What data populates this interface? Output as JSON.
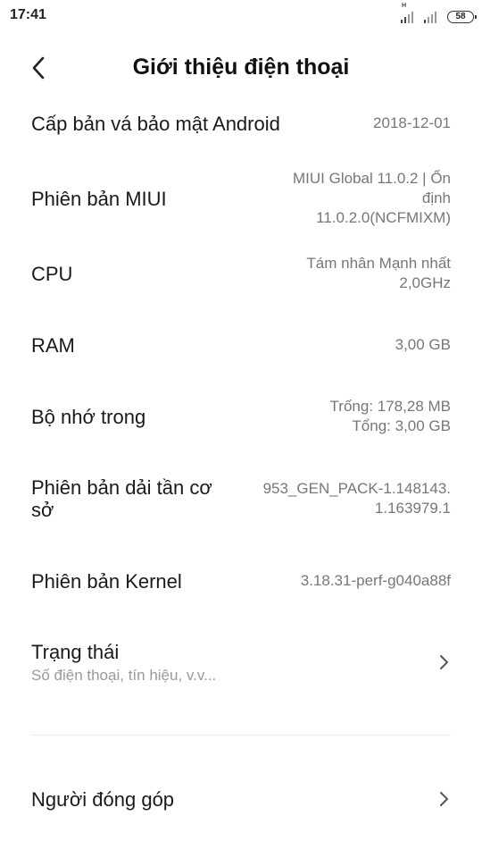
{
  "status_bar": {
    "time": "17:41",
    "signal1_tag": "H",
    "battery": "58"
  },
  "header": {
    "back_icon": "chevron-left-icon",
    "title": "Giới thiệu điện thoại"
  },
  "rows": {
    "security_patch": {
      "label": "Cấp bản vá bảo mật Android",
      "value": "2018-12-01"
    },
    "miui_version": {
      "label": "Phiên bản MIUI",
      "value_lines": [
        "MIUI Global 11.0.2 | Ổn",
        "định",
        "11.0.2.0(NCFMIXM)"
      ]
    },
    "cpu": {
      "label": "CPU",
      "value_lines": [
        "Tám nhân Mạnh nhất",
        "2,0GHz"
      ]
    },
    "ram": {
      "label": "RAM",
      "value": "3,00 GB"
    },
    "storage": {
      "label": "Bộ nhớ trong",
      "value_lines": [
        "Trống: 178,28 MB",
        "Tổng: 3,00 GB"
      ]
    },
    "baseband": {
      "label_lines": [
        "Phiên bản dải tần cơ",
        "sở"
      ],
      "value_lines": [
        "953_GEN_PACK-1.148143.",
        "1.163979.1"
      ]
    },
    "kernel": {
      "label": "Phiên bản Kernel",
      "value": "3.18.31-perf-g040a88f"
    },
    "status": {
      "label": "Trạng thái",
      "sublabel": "Số điện thoại, tín hiệu, v.v..."
    },
    "contributors": {
      "label": "Người đóng góp"
    }
  },
  "icons": {
    "chevron_right": "chevron-right-icon"
  }
}
